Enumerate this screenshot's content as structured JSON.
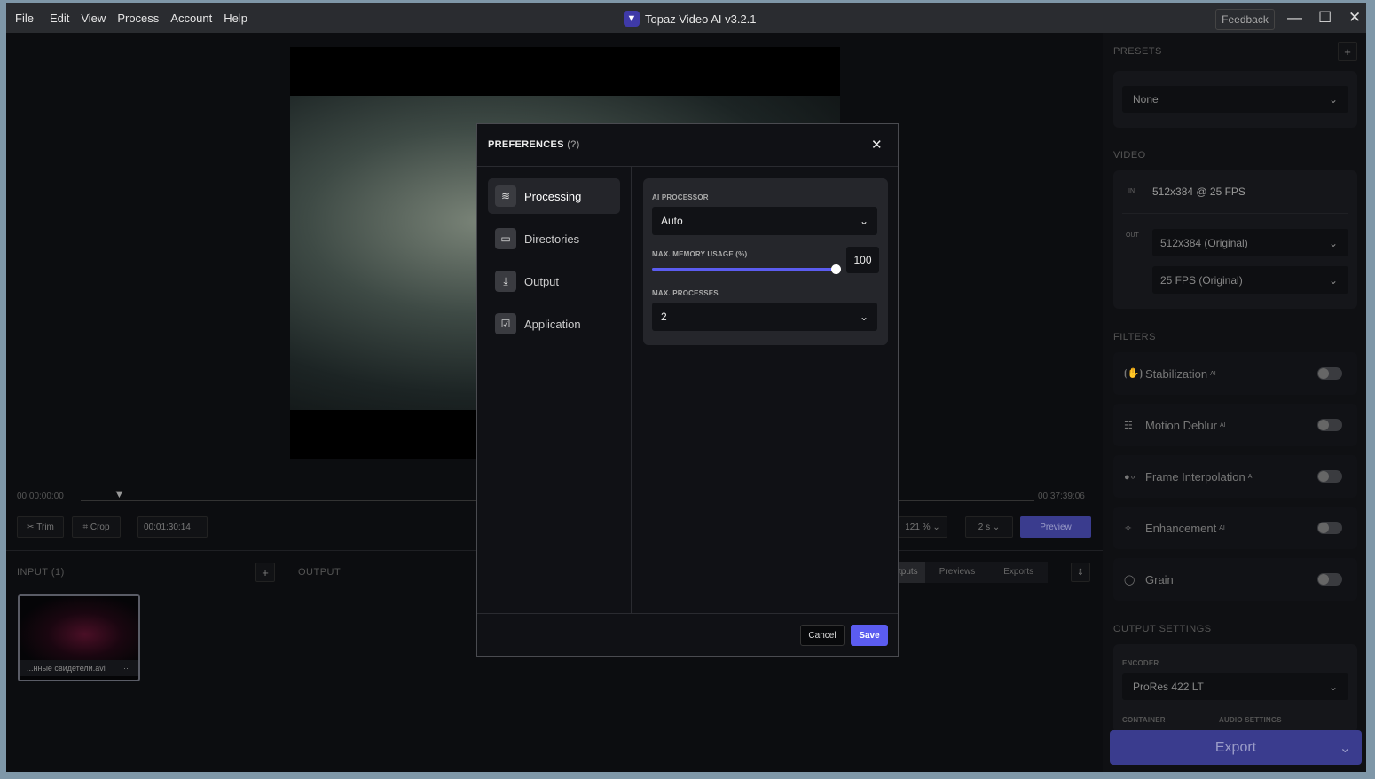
{
  "app": {
    "title": "Topaz Video AI  v3.2.1",
    "menu": [
      "File",
      "Edit",
      "View",
      "Process",
      "Account",
      "Help"
    ],
    "feedback": "Feedback",
    "minimize": "—",
    "maximize": "☐",
    "close": "✕"
  },
  "timeline": {
    "start": "00:00:00:00",
    "end": "00:37:39:06",
    "trim": "Trim",
    "crop": "Crop",
    "current": "00:01:30:14",
    "zoom": "121 %",
    "zoom_unit": "",
    "step": "2 s",
    "preview": "Preview"
  },
  "input": {
    "title": "INPUT (1)",
    "add": "+",
    "file": "...нные свидетели.avi",
    "more": "···"
  },
  "output": {
    "title": "OUTPUT",
    "tabs": [
      "tputs",
      "Previews",
      "Exports"
    ]
  },
  "right": {
    "presets_title": "PRESETS",
    "preset_value": "None",
    "add": "+",
    "video_title": "VIDEO",
    "in_label": "IN",
    "in_value": "512x384 @ 25 FPS",
    "out_label": "OUT",
    "out_res": "512x384 (Original)",
    "out_fps": "25 FPS (Original)",
    "filters_title": "FILTERS",
    "filters": [
      {
        "label": "Stabilization",
        "ai": "AI",
        "icon": "stabilization-icon",
        "on": false
      },
      {
        "label": "Motion Deblur",
        "ai": "AI",
        "icon": "motion-deblur-icon",
        "on": false
      },
      {
        "label": "Frame Interpolation",
        "ai": "AI",
        "icon": "frame-interpolation-icon",
        "on": false
      },
      {
        "label": "Enhancement",
        "ai": "AI",
        "icon": "sparkle-icon",
        "on": false
      },
      {
        "label": "Grain",
        "ai": "",
        "icon": "grain-icon",
        "on": false
      }
    ],
    "output_title": "OUTPUT SETTINGS",
    "encoder_label": "ENCODER",
    "encoder": "ProRes 422 LT",
    "container_label": "CONTAINER",
    "audio_label": "AUDIO SETTINGS",
    "export": "Export"
  },
  "dialog": {
    "title": "PREFERENCES",
    "help": "(?)",
    "close": "✕",
    "nav": [
      {
        "label": "Processing",
        "icon": "sliders-icon",
        "active": true
      },
      {
        "label": "Directories",
        "icon": "folder-icon"
      },
      {
        "label": "Output",
        "icon": "download-icon"
      },
      {
        "label": "Application",
        "icon": "application-icon"
      }
    ],
    "ai_processor_label": "AI PROCESSOR",
    "ai_processor": "Auto",
    "memory_label": "MAX. MEMORY USAGE (%)",
    "memory": "100",
    "memory_pct": 100,
    "processes_label": "MAX. PROCESSES",
    "processes": "2",
    "cancel": "Cancel",
    "save": "Save"
  },
  "colors": {
    "accent": "#5b5cf0",
    "export": "#3a3c8e"
  }
}
